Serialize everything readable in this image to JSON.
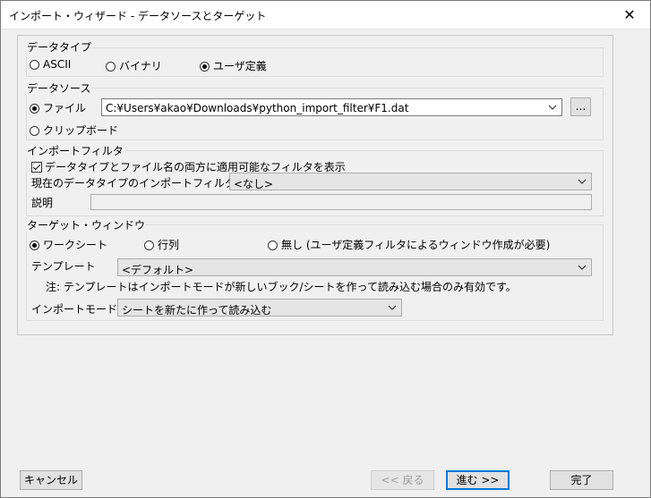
{
  "window": {
    "title": "インポート・ウィザード - データソースとターゲット",
    "close_icon": "close-icon"
  },
  "data_type": {
    "group_label": "データタイプ",
    "options": {
      "ascii": "ASCII",
      "binary": "バイナリ",
      "user": "ユーザ定義"
    },
    "selected": "user"
  },
  "data_source": {
    "group_label": "データソース",
    "file_label": "ファイル",
    "file_path": "C:¥Users¥akao¥Downloads¥python_import_filter¥F1.dat",
    "browse_label": "...",
    "clipboard_label": "クリップボード",
    "selected": "file"
  },
  "import_filter": {
    "group_label": "インポートフィルタ",
    "checkbox_label": "データタイプとファイル名の両方に適用可能なフィルタを表示",
    "checkbox_checked": true,
    "current_label": "現在のデータタイプのインポートフィルタ",
    "current_value": "<なし>",
    "description_label": "説明",
    "description_value": ""
  },
  "target_window": {
    "group_label": "ターゲット・ウィンドウ",
    "options": {
      "worksheet": "ワークシート",
      "matrix": "行列",
      "none": "無し (ユーザ定義フィルタによるウィンドウ作成が必要)"
    },
    "selected": "worksheet",
    "template_label": "テンプレート",
    "template_value": "<デフォルト>",
    "note": "注: テンプレートはインポートモードが新しいブック/シートを作って読み込む場合のみ有効です。",
    "import_mode_label": "インポートモード",
    "import_mode_value": "シートを新たに作って読み込む"
  },
  "footer": {
    "cancel": "キャンセル",
    "back": "<< 戻る",
    "next": "進む >>",
    "finish": "完了"
  },
  "colors": {
    "accent": "#0078d7",
    "disabled_text": "#a0a0a0",
    "background": "#f0f0f0"
  }
}
